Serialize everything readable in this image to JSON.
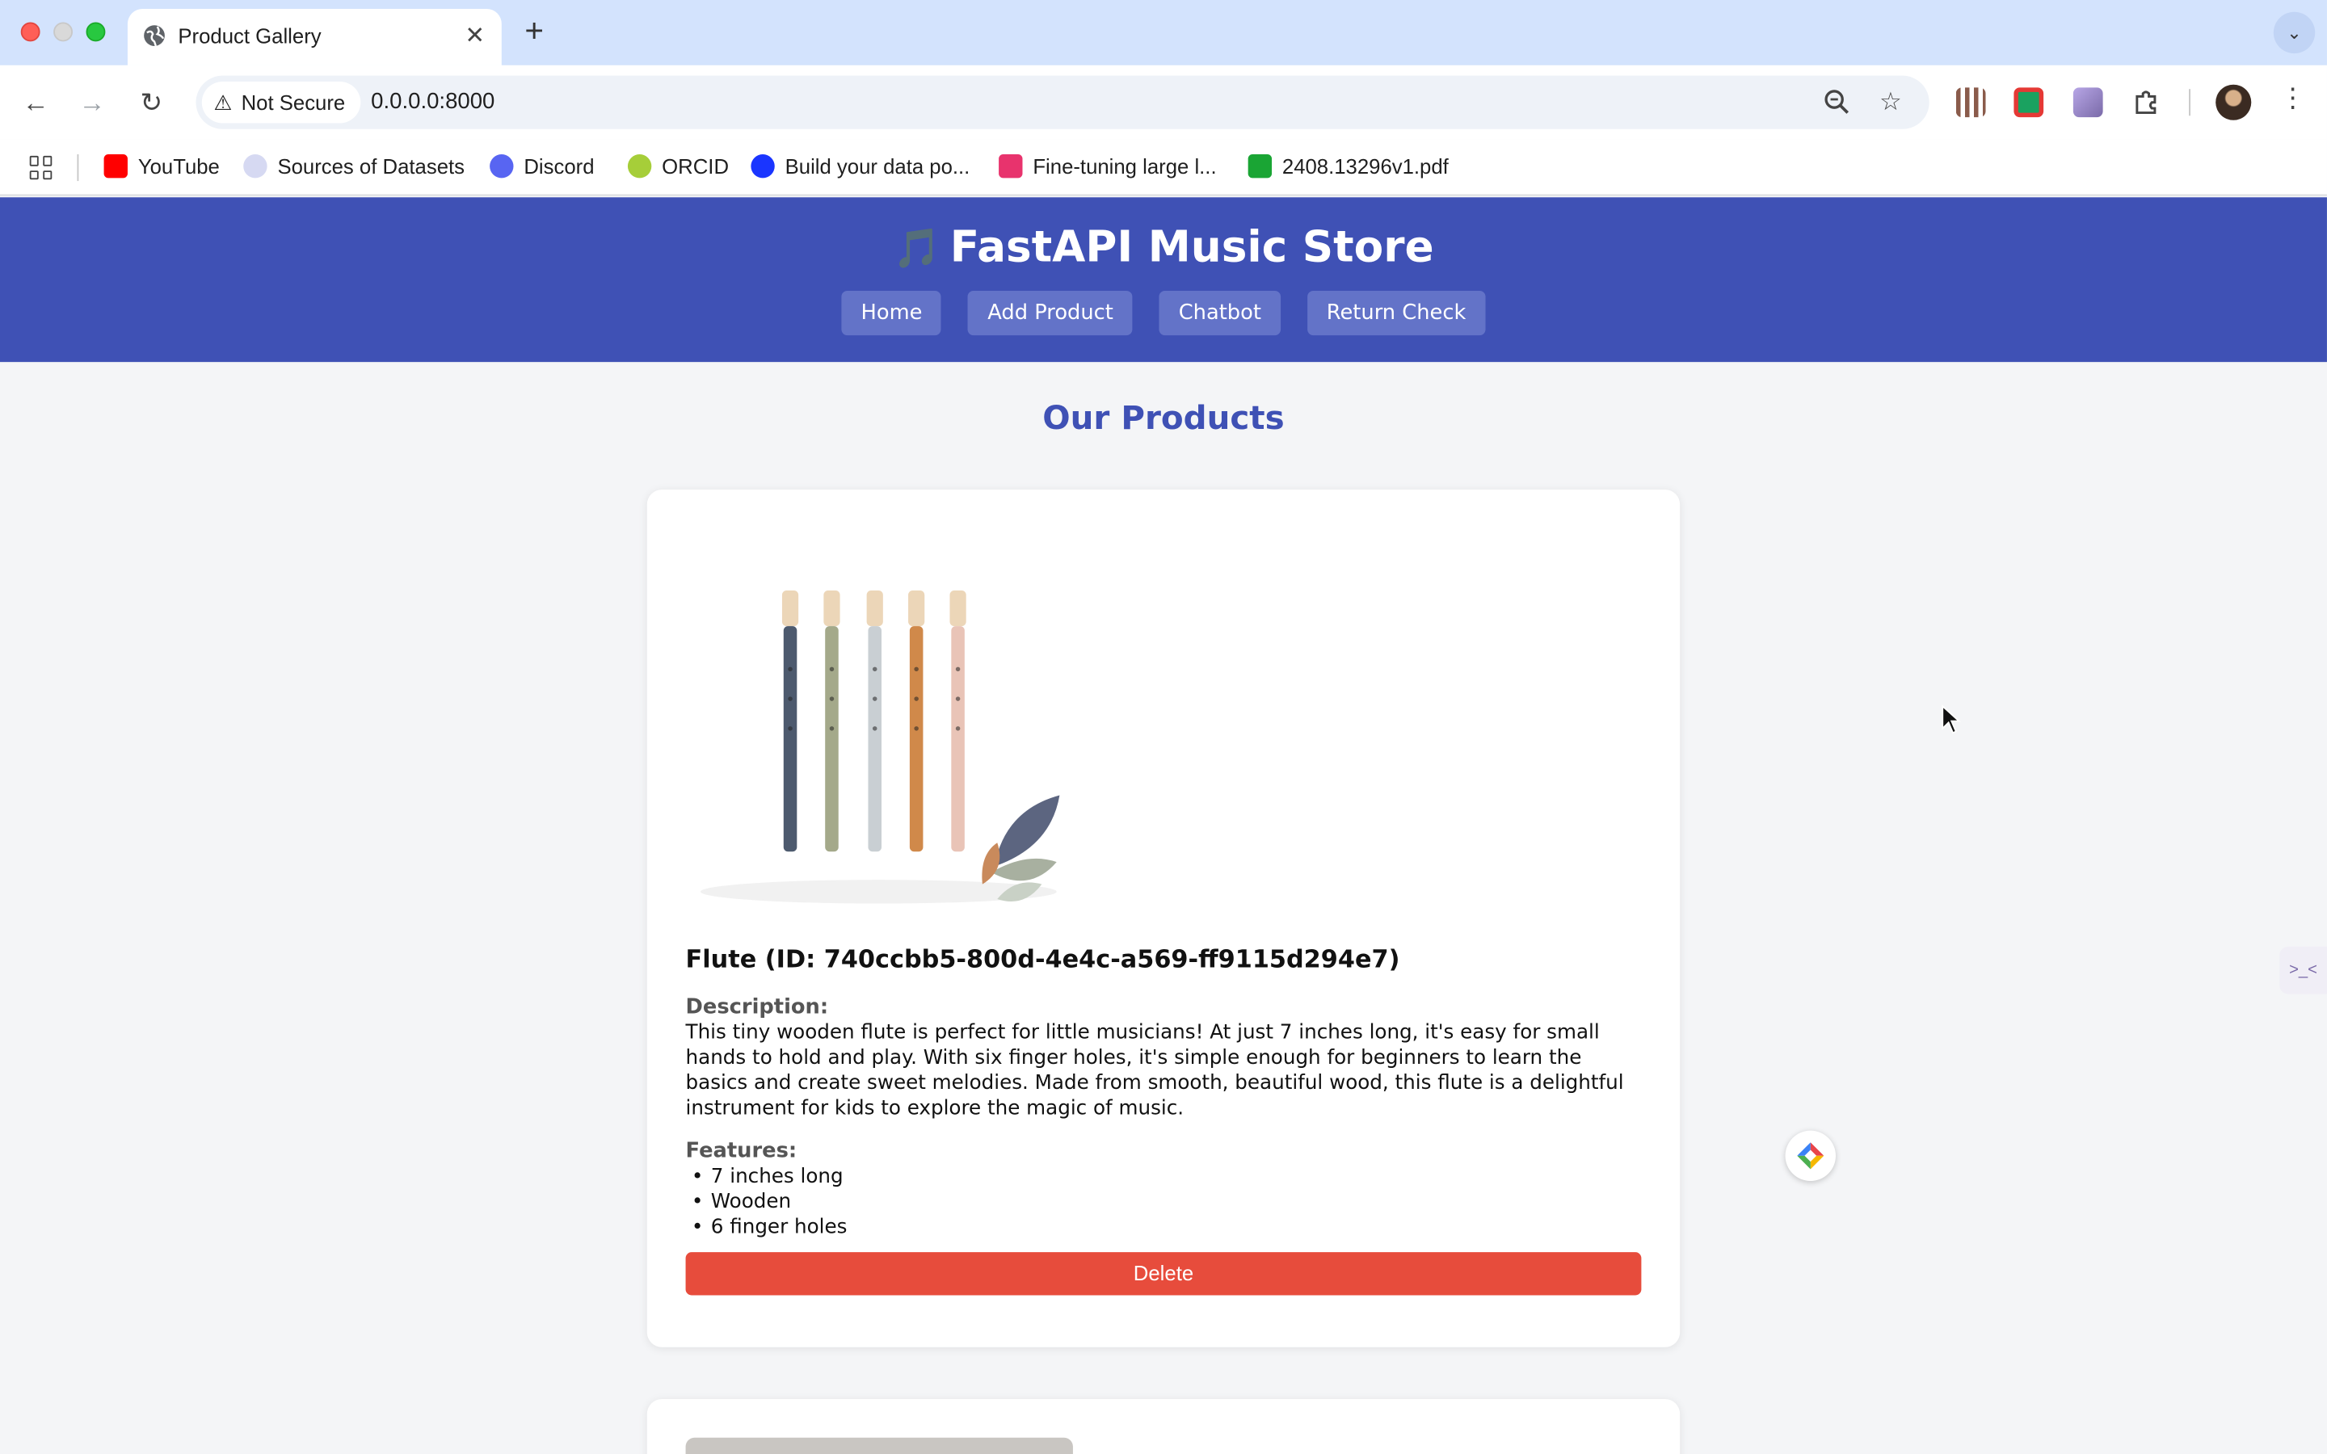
{
  "browser": {
    "tab_title": "Product Gallery",
    "tab_close": "✕",
    "new_tab": "+",
    "security_label": "Not Secure",
    "url": "0.0.0.0:8000",
    "bookmarks": [
      {
        "label": "YouTube",
        "color": "#ff0000"
      },
      {
        "label": "Sources of Datasets",
        "color": "#9aa0d6"
      },
      {
        "label": "Discord",
        "color": "#5865f2"
      },
      {
        "label": "ORCID",
        "color": "#a6ce39"
      },
      {
        "label": "Build your data po...",
        "color": "#1a35ff"
      },
      {
        "label": "Fine-tuning large l...",
        "color": "#e8336d"
      },
      {
        "label": "2408.13296v1.pdf",
        "color": "#1aa534"
      }
    ]
  },
  "site": {
    "icon": "🎵",
    "title": "FastAPI Music Store",
    "nav": [
      "Home",
      "Add Product",
      "Chatbot",
      "Return Check"
    ],
    "heading": "Our Products",
    "colors": {
      "header": "#3f51b5",
      "delete": "#e74c3c"
    }
  },
  "product": {
    "name": "Flute (ID: 740ccbb5-800d-4e4c-a569-ff9115d294e7)",
    "description_label": "Description:",
    "description": "This tiny wooden flute is perfect for little musicians! At just 7 inches long, it's easy for small hands to hold and play. With six finger holes, it's simple enough for beginners to learn the basics and create sweet melodies. Made from smooth, beautiful wood, this flute is a delightful instrument for kids to explore the magic of music.",
    "features_label": "Features:",
    "features": [
      "7 inches long",
      "Wooden",
      "6 finger holes"
    ],
    "delete_label": "Delete",
    "flute_colors": [
      "#4d5a6e",
      "#a4a98a",
      "#c9cfd3",
      "#d0894a",
      "#e9c4b7"
    ]
  }
}
